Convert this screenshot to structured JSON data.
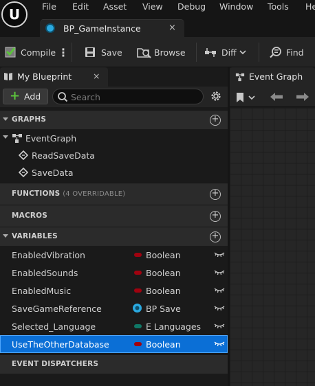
{
  "menu": {
    "items": [
      "File",
      "Edit",
      "Asset",
      "View",
      "Debug",
      "Window",
      "Tools",
      "He"
    ]
  },
  "document_tab": {
    "title": "BP_GameInstance",
    "close": "×"
  },
  "toolbar": {
    "compile_label": "Compile",
    "save_label": "Save",
    "browse_label": "Browse",
    "diff_label": "Diff",
    "find_label": "Find"
  },
  "my_blueprint": {
    "tab_title": "My Blueprint",
    "tab_close": "×",
    "add_label": "Add",
    "search_placeholder": "Search"
  },
  "sections": {
    "graphs": "GRAPHS",
    "functions": "FUNCTIONS",
    "functions_note": "(4 OVERRIDABLE)",
    "macros": "MACROS",
    "variables": "VARIABLES",
    "event_dispatchers": "EVENT DISPATCHERS"
  },
  "graphs": {
    "event_graph": "EventGraph",
    "events": [
      "ReadSaveData",
      "SaveData"
    ]
  },
  "variables": [
    {
      "name": "EnabledVibration",
      "type": "Boolean",
      "type_color": "#a0020f",
      "selected": false
    },
    {
      "name": "EnabledSounds",
      "type": "Boolean",
      "type_color": "#a0020f",
      "selected": false
    },
    {
      "name": "EnabledMusic",
      "type": "Boolean",
      "type_color": "#a0020f",
      "selected": false
    },
    {
      "name": "SaveGameReference",
      "type": "BP Save",
      "type_color": "#2aa9e0",
      "selected": false
    },
    {
      "name": "Selected_Language",
      "type": "E Languages",
      "type_color": "#0f7766",
      "selected": false
    },
    {
      "name": "UseTheOtherDatabase",
      "type": "Boolean",
      "type_color": "#a0020f",
      "selected": true
    }
  ],
  "graph_panel": {
    "tab_title": "Event Graph"
  },
  "colors": {
    "selection": "#0b6fd6",
    "add_plus": "#5cc23c",
    "boolean": "#a0020f",
    "enum": "#0f7766",
    "object": "#2aa9e0"
  }
}
